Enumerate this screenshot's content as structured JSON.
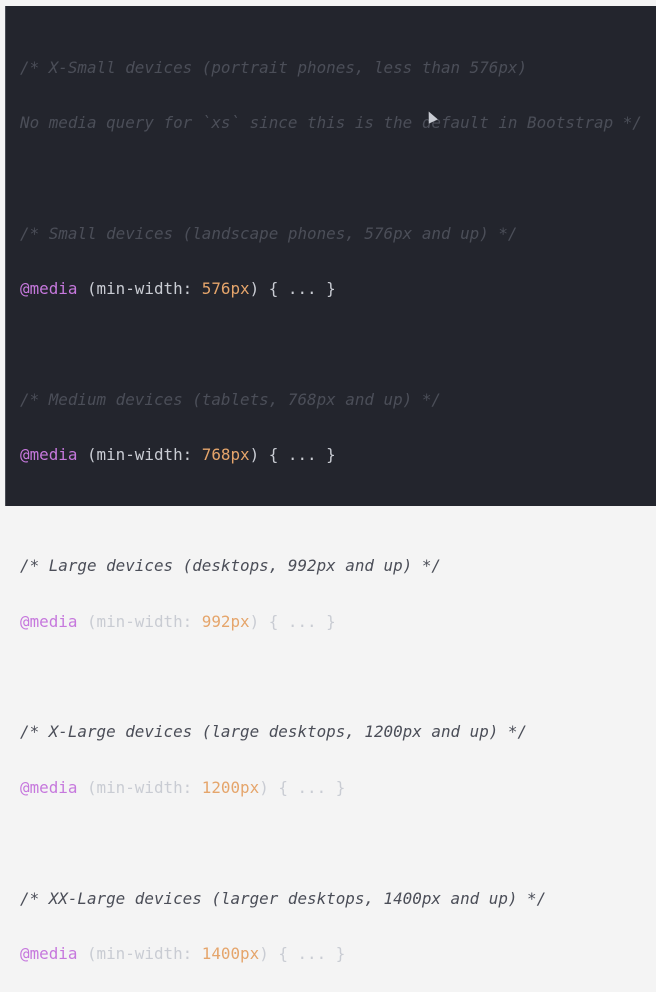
{
  "blocks": [
    {
      "comment": "/* X-Small devices (portrait phones, less than 576px)",
      "comment2": "No media query for `xs` since this is the default in Bootstrap */"
    },
    {
      "comment": "/* Small devices (landscape phones, 576px and up) */",
      "at": "@media",
      "pre": " (min-width: ",
      "value": "576px",
      "post": ") { ... }"
    },
    {
      "comment": "/* Medium devices (tablets, 768px and up) */",
      "at": "@media",
      "pre": " (min-width: ",
      "value": "768px",
      "post": ") { ... }"
    },
    {
      "comment": "/* Large devices (desktops, 992px and up) */",
      "at": "@media",
      "pre": " (min-width: ",
      "value": "992px",
      "post": ") { ... }"
    },
    {
      "comment": "/* X-Large devices (large desktops, 1200px and up) */",
      "at": "@media",
      "pre": " (min-width: ",
      "value": "1200px",
      "post": ") { ... }"
    },
    {
      "comment": "/* XX-Large devices (larger desktops, 1400px and up) */",
      "at": "@media",
      "pre": " (min-width: ",
      "value": "1400px",
      "post": ") { ... }"
    }
  ],
  "colors": {
    "background": "#23252d",
    "comment": "#4b4e58",
    "keyword": "#c678dd",
    "number": "#e5a56b",
    "text": "#c9ccd3"
  }
}
